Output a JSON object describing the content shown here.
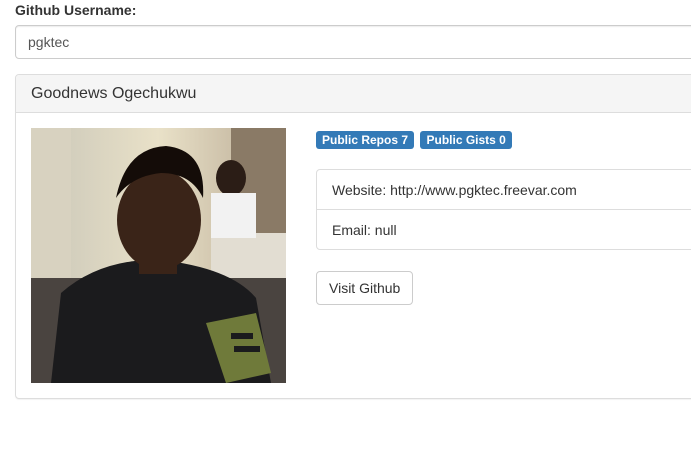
{
  "search": {
    "label": "Github Username:",
    "value": "pgktec"
  },
  "profile": {
    "name": "Goodnews Ogechukwu",
    "badges": {
      "repos": "Public Repos 7",
      "gists": "Public Gists 0"
    },
    "website": "Website: http://www.pgktec.freevar.com",
    "email": "Email: null",
    "visit_button": "Visit Github"
  },
  "colors": {
    "badge": "#337ab7",
    "panel_heading_bg": "#f5f5f5",
    "border": "#dddddd"
  }
}
